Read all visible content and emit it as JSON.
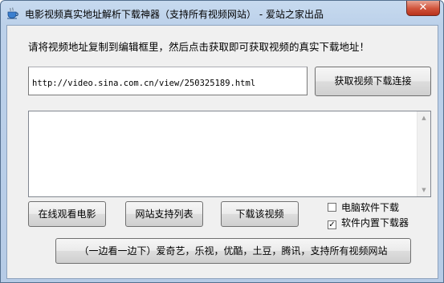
{
  "window": {
    "title": "电影视频真实地址解析下载神器（支持所有视频网站） - 爱站之家出品",
    "close_label": "✕"
  },
  "instruction": "请将视频地址复制到编辑框里，然后点击获取即可获取视频的真实下载地址！",
  "url_input": {
    "value": "http://video.sina.com.cn/view/250325189.html"
  },
  "buttons": {
    "get_link": "获取视频下载连接",
    "watch_online": "在线观看电影",
    "site_list": "网站支持列表",
    "download": "下载该视频"
  },
  "checkboxes": [
    {
      "label": "电脑软件下载",
      "checked": false
    },
    {
      "label": "软件内置下载器",
      "checked": true
    }
  ],
  "bottom_button": "（一边看一边下）爱奇艺，乐视，优酷，土豆，腾讯，支持所有视频网站",
  "icons": {
    "app": "teacup-icon",
    "close": "close-icon"
  }
}
